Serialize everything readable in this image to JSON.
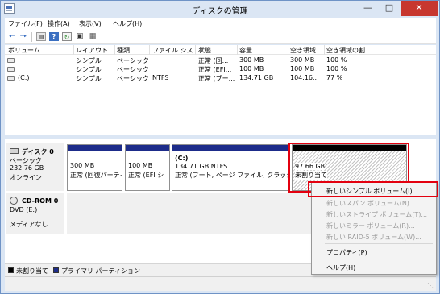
{
  "window": {
    "title": "ディスクの管理"
  },
  "menu": [
    "ファイル(F)",
    "操作(A)",
    "表示(V)",
    "ヘルプ(H)"
  ],
  "volume_list": {
    "columns": [
      "ボリューム",
      "レイアウト",
      "種類",
      "ファイル シス...",
      "状態",
      "容量",
      "空き領域",
      "空き領域の割..."
    ],
    "rows": [
      [
        "",
        "シンプル",
        "ベーシック",
        "",
        "正常 (回...",
        "300 MB",
        "300 MB",
        "100 %"
      ],
      [
        "",
        "シンプル",
        "ベーシック",
        "",
        "正常 (EFI...",
        "100 MB",
        "100 MB",
        "100 %"
      ],
      [
        "(C:)",
        "シンプル",
        "ベーシック",
        "NTFS",
        "正常 (ブー...",
        "134.71 GB",
        "104.16...",
        "77 %"
      ]
    ]
  },
  "disk0": {
    "name": "ディスク 0",
    "type": "ベーシック",
    "size": "232.76 GB",
    "status": "オンライン",
    "partitions": [
      {
        "size": "300 MB",
        "status": "正常 (回復パーティ"
      },
      {
        "size": "100 MB",
        "status": "正常 (EFI シ"
      },
      {
        "label": "(C:)",
        "size": "134.71 GB NTFS",
        "status": "正常 (ブート, ページ ファイル, クラッシュ ダン"
      },
      {
        "size": "97.66 GB",
        "status": "未割り当て"
      }
    ]
  },
  "cdrom0": {
    "name": "CD-ROM 0",
    "drive": "DVD (E:)",
    "status": "メディアなし"
  },
  "legend": [
    {
      "label": "未割り当て",
      "color": "#000000"
    },
    {
      "label": "プライマリ パーティション",
      "color": "#1d2c8a"
    }
  ],
  "context_menu": [
    {
      "label": "新しいシンプル ボリューム(I)...",
      "enabled": true
    },
    {
      "label": "新しいスパン ボリューム(N)...",
      "enabled": false
    },
    {
      "label": "新しいストライプ ボリューム(T)...",
      "enabled": false
    },
    {
      "label": "新しいミラー ボリューム(R)...",
      "enabled": false
    },
    {
      "label": "新しい RAID-5 ボリューム(W)...",
      "enabled": false
    },
    {
      "label": "プロパティ(P)",
      "enabled": true
    },
    {
      "label": "ヘルプ(H)",
      "enabled": true
    }
  ],
  "colors": {
    "primary_partition": "#1d2c8a",
    "unallocated": "#000000",
    "highlight": "#e3000f",
    "close_button": "#c7372f"
  },
  "icons": [
    "back-icon",
    "forward-icon",
    "properties-icon",
    "help-icon",
    "refresh-icon",
    "rescan-icon",
    "settings-icon"
  ]
}
